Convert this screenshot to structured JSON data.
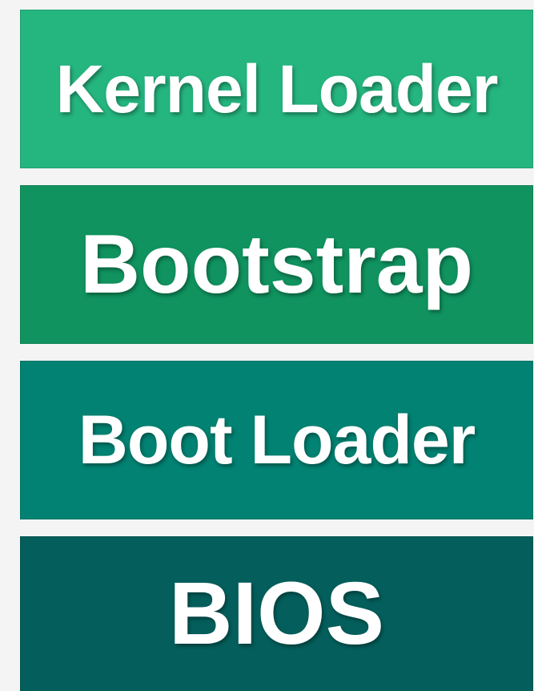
{
  "layers": [
    {
      "label": "Kernel Loader",
      "color": "#25b57f"
    },
    {
      "label": "Bootstrap",
      "color": "#10935f"
    },
    {
      "label": "Boot Loader",
      "color": "#018272"
    },
    {
      "label": "BIOS",
      "color": "#045f5c"
    }
  ]
}
